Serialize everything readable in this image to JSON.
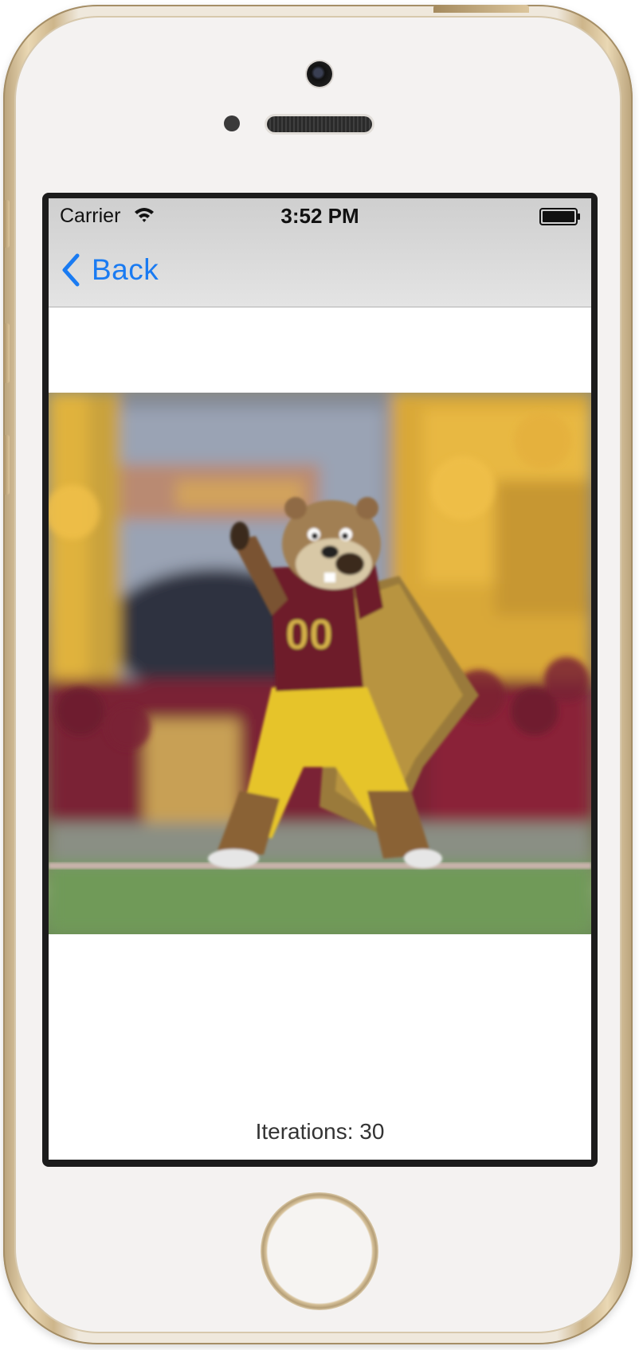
{
  "status_bar": {
    "carrier": "Carrier",
    "time": "3:52 PM"
  },
  "nav": {
    "back_label": "Back"
  },
  "content": {
    "iterations_text": "Iterations: 30"
  },
  "colors": {
    "ios_blue": "#1a7bf2",
    "nav_bar_gray": "#d7d7d7",
    "jersey_maroon": "#6e1a2a",
    "jersey_gold": "#e6c84a"
  },
  "icons": [
    "wifi-icon",
    "battery-icon",
    "chevron-left-icon"
  ]
}
